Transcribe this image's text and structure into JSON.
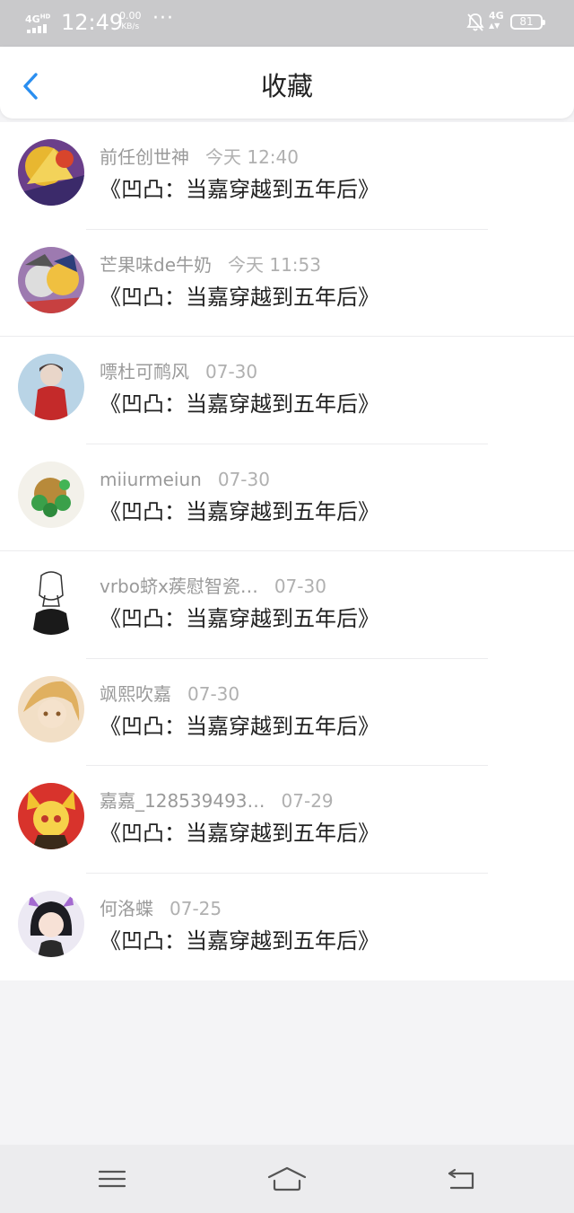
{
  "status_bar": {
    "network": "4G",
    "network_sup": "HD",
    "time": "12:49",
    "speed_value": "0.00",
    "speed_unit": "KB/s",
    "more": "···",
    "right_network": "4G",
    "battery": "81"
  },
  "header": {
    "title": "收藏",
    "back_icon": "chevron-left-icon",
    "accent_color": "#2a8ef0"
  },
  "favorites": [
    {
      "name": "前任创世神",
      "time": "今天 12:40",
      "title": "《凹凸：当嘉穿越到五年后》"
    },
    {
      "name": "芒果味de牛奶",
      "time": "今天 11:53",
      "title": "《凹凸：当嘉穿越到五年后》"
    },
    {
      "name": "嘌杜可鸸风",
      "time": "07-30",
      "title": "《凹凸：当嘉穿越到五年后》"
    },
    {
      "name": "miiurmeiun",
      "time": "07-30",
      "title": "《凹凸：当嘉穿越到五年后》"
    },
    {
      "name": "vrbo蛴x蒺慰智瓷…",
      "time": "07-30",
      "title": "《凹凸：当嘉穿越到五年后》"
    },
    {
      "name": "飒熙吹嘉",
      "time": "07-30",
      "title": "《凹凸：当嘉穿越到五年后》"
    },
    {
      "name": "嘉嘉_128539493…",
      "time": "07-29",
      "title": "《凹凸：当嘉穿越到五年后》"
    },
    {
      "name": "何洛蝶",
      "time": "07-25",
      "title": "《凹凸：当嘉穿越到五年后》"
    }
  ],
  "bottom_nav": {
    "menu_icon": "menu-icon",
    "home_icon": "home-icon",
    "back_icon": "back-icon"
  }
}
